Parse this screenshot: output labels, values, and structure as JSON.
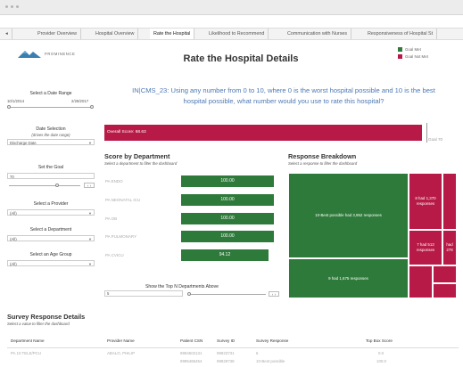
{
  "window": {
    "title": ""
  },
  "tabs": [
    {
      "label": "◂",
      "active": false
    },
    {
      "label": "Provider Overview",
      "active": false
    },
    {
      "label": "Hospital Overview",
      "active": false
    },
    {
      "label": "Rate the Hospital",
      "active": true
    },
    {
      "label": "Likelihood to Recommend",
      "active": false
    },
    {
      "label": "Communication with Nurses",
      "active": false
    },
    {
      "label": "Responsiveness of Hospital St",
      "active": false
    }
  ],
  "brand": {
    "name": "PROMINENCE"
  },
  "page_title": "Rate the Hospital Details",
  "legend": {
    "met": {
      "label": "Goal Met",
      "color": "#2e7a3a"
    },
    "not_met": {
      "label": "Goal Not Met",
      "color": "#b71a46"
    }
  },
  "question": {
    "line1": "IN|CMS_23: Using any number from 0 to 10, where 0 is the worst hospital possible and 10 is the best",
    "line2": "hospital possible, what number would you use to rate this hospital?"
  },
  "sidebar": {
    "date_range": {
      "label": "Select a Date Range",
      "start": "10/1/2014",
      "end": "2/28/2017"
    },
    "date_selection": {
      "label": "Date Selection",
      "sublabel": "(drives the date range)",
      "value": "Discharge Date"
    },
    "goal": {
      "label": "Set the Goal",
      "value": "70"
    },
    "provider": {
      "label": "Select a Provider",
      "value": "(All)"
    },
    "department": {
      "label": "Select a Department",
      "value": "(All)"
    },
    "age_group": {
      "label": "Select an Age Group",
      "value": "(All)"
    }
  },
  "overall": {
    "label": "Overall Score: 68.63",
    "goal_label": "Goal 70",
    "score": 68.63
  },
  "score_by_department": {
    "title": "Score by Department",
    "subtitle": "Select a department to filter the dashboard",
    "rows": [
      {
        "dept": "PA ENDO",
        "value": "100.00"
      },
      {
        "dept": "PA NEONATAL ICU",
        "value": "100.00"
      },
      {
        "dept": "PA OB",
        "value": "100.00"
      },
      {
        "dept": "PA PULMONARY",
        "value": "100.00"
      },
      {
        "dept": "PA CVICU",
        "value": "94.12"
      }
    ]
  },
  "top_n": {
    "label": "Show the Top N Departments Above",
    "value": "5"
  },
  "response_breakdown": {
    "title": "Response Breakdown",
    "subtitle": "Select a response to filter the dashboard",
    "tiles": [
      {
        "label": "10-Best possible had 3,952 responses",
        "color": "#2e7a3a"
      },
      {
        "label": "9 had 1,675 responses",
        "color": "#2e7a3a"
      },
      {
        "label": "8 had 1,370 responses",
        "color": "#b71a46"
      },
      {
        "label": "7 had 513 responses",
        "color": "#b71a46"
      },
      {
        "label": "had 278",
        "color": "#b71a46"
      }
    ]
  },
  "survey_details": {
    "title": "Survey Response Details",
    "subtitle": "Select a value to filter the dashboard",
    "columns": [
      "Department Name",
      "Provider Name",
      "Patient CSN",
      "Survey ID",
      "Survey Response",
      "Top Box Score"
    ],
    "rows": [
      [
        "PA 10 TELE/PCU",
        "ABALO, PHILIP",
        "9994502131",
        "99923731",
        "6",
        "0.0"
      ],
      [
        "",
        "",
        "9995486454",
        "99929738",
        "10-Best possible",
        "100.0"
      ]
    ]
  }
}
